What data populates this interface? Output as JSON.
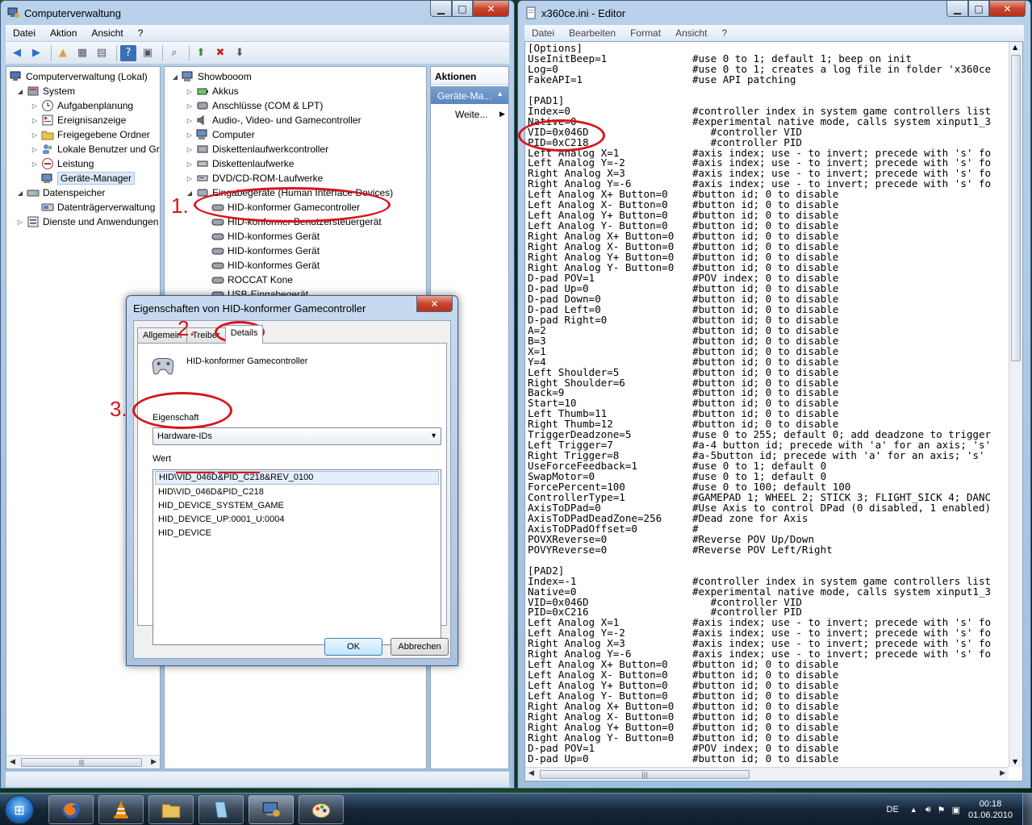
{
  "compmgmt": {
    "title": "Computerverwaltung",
    "menu": [
      "Datei",
      "Aktion",
      "Ansicht",
      "?"
    ],
    "left_tree": [
      {
        "label": "Computerverwaltung (Lokal)",
        "indent": 0,
        "twisty": ""
      },
      {
        "label": "System",
        "indent": 1,
        "twisty": "◢"
      },
      {
        "label": "Aufgabenplanung",
        "indent": 2,
        "twisty": "▷"
      },
      {
        "label": "Ereignisanzeige",
        "indent": 2,
        "twisty": "▷"
      },
      {
        "label": "Freigegebene Ordner",
        "indent": 2,
        "twisty": "▷"
      },
      {
        "label": "Lokale Benutzer und Gr",
        "indent": 2,
        "twisty": "▷"
      },
      {
        "label": "Leistung",
        "indent": 2,
        "twisty": "▷"
      },
      {
        "label": "Geräte-Manager",
        "indent": 2,
        "twisty": "",
        "selected": true
      },
      {
        "label": "Datenspeicher",
        "indent": 1,
        "twisty": "◢"
      },
      {
        "label": "Datenträgerverwaltung",
        "indent": 2,
        "twisty": ""
      },
      {
        "label": "Dienste und Anwendungen",
        "indent": 1,
        "twisty": "▷"
      }
    ],
    "device_tree": [
      {
        "label": "Showbooom",
        "indent": 0,
        "twisty": "◢"
      },
      {
        "label": "Akkus",
        "indent": 1,
        "twisty": "▷"
      },
      {
        "label": "Anschlüsse (COM & LPT)",
        "indent": 1,
        "twisty": "▷"
      },
      {
        "label": "Audio-, Video- und Gamecontroller",
        "indent": 1,
        "twisty": "▷"
      },
      {
        "label": "Computer",
        "indent": 1,
        "twisty": "▷"
      },
      {
        "label": "Diskettenlaufwerkcontroller",
        "indent": 1,
        "twisty": "▷"
      },
      {
        "label": "Diskettenlaufwerke",
        "indent": 1,
        "twisty": "▷"
      },
      {
        "label": "DVD/CD-ROM-Laufwerke",
        "indent": 1,
        "twisty": "▷"
      },
      {
        "label": "Eingabegeräte (Human Interface Devices)",
        "indent": 1,
        "twisty": "◢"
      },
      {
        "label": "HID-konformer Gamecontroller",
        "indent": 2,
        "twisty": ""
      },
      {
        "label": "HID-konformer Benutzersteuergerät",
        "indent": 2,
        "twisty": ""
      },
      {
        "label": "HID-konformes Gerät",
        "indent": 2,
        "twisty": ""
      },
      {
        "label": "HID-konformes Gerät",
        "indent": 2,
        "twisty": ""
      },
      {
        "label": "HID-konformes Gerät",
        "indent": 2,
        "twisty": ""
      },
      {
        "label": "ROCCAT Kone",
        "indent": 2,
        "twisty": ""
      },
      {
        "label": "USB-Eingabegerät",
        "indent": 2,
        "twisty": ""
      }
    ],
    "actions": {
      "header": "Aktionen",
      "selected": "Geräte-Ma...",
      "more": "Weite..."
    }
  },
  "dialog": {
    "title": "Eigenschaften von HID-konformer Gamecontroller",
    "tabs": [
      "Allgemein",
      "Treiber",
      "Details"
    ],
    "device_name": "HID-konformer Gamecontroller",
    "property_label": "Eigenschaft",
    "property_value": "Hardware-IDs",
    "value_label": "Wert",
    "values": [
      "HID\\VID_046D&PID_C218&REV_0100",
      "HID\\VID_046D&PID_C218",
      "HID_DEVICE_SYSTEM_GAME",
      "HID_DEVICE_UP:0001_U:0004",
      "HID_DEVICE"
    ],
    "ok_label": "OK",
    "cancel_label": "Abbrechen"
  },
  "annotations": {
    "step1": "1.",
    "step2": "2.",
    "step3": "3.",
    "color": "#d8141c"
  },
  "notepad": {
    "title": "x360ce.ini - Editor",
    "menu": [
      "Datei",
      "Bearbeiten",
      "Format",
      "Ansicht",
      "?"
    ],
    "content": "[Options]\nUseInitBeep=1              #use 0 to 1; default 1; beep on init\nLog=0                      #use 0 to 1; creates a log file in folder 'x360ce\nFakeAPI=1                  #use API patching\n\n[PAD1]\nIndex=0                    #controller index in system game controllers list\nNative=0                   #experimental native mode, calls system xinput1_3\nVID=0x046D                    #controller VID\nPID=0xC218                    #controller PID\nLeft Analog X=1            #axis index; use - to invert; precede with 's' fo\nLeft Analog Y=-2           #axis index; use - to invert; precede with 's' fo\nRight Analog X=3           #axis index; use - to invert; precede with 's' fo\nRight Analog Y=-6          #axis index; use - to invert; precede with 's' fo\nLeft Analog X+ Button=0    #button id; 0 to disable\nLeft Analog X- Button=0    #button id; 0 to disable\nLeft Analog Y+ Button=0    #button id; 0 to disable\nLeft Analog Y- Button=0    #button id; 0 to disable\nRight Analog X+ Button=0   #button id; 0 to disable\nRight Analog X- Button=0   #button id; 0 to disable\nRight Analog Y+ Button=0   #button id; 0 to disable\nRight Analog Y- Button=0   #button id; 0 to disable\nD-pad POV=1                #POV index; 0 to disable\nD-pad Up=0                 #button id; 0 to disable\nD-pad Down=0               #button id; 0 to disable\nD-pad Left=0               #button id; 0 to disable\nD-pad Right=0              #button id; 0 to disable\nA=2                        #button id; 0 to disable\nB=3                        #button id; 0 to disable\nX=1                        #button id; 0 to disable\nY=4                        #button id; 0 to disable\nLeft Shoulder=5            #button id; 0 to disable\nRight Shoulder=6           #button id; 0 to disable\nBack=9                     #button id; 0 to disable\nStart=10                   #button id; 0 to disable\nLeft Thumb=11              #button id; 0 to disable\nRight Thumb=12             #button id; 0 to disable\nTriggerDeadzone=5          #use 0 to 255; default 0; add deadzone to trigger\nLeft Trigger=7             #a-4 button id; precede with 'a' for an axis; 's'\nRight Trigger=8            #a-5button id; precede with 'a' for an axis; 's' \nUseForceFeedback=1         #use 0 to 1; default 0\nSwapMotor=0                #use 0 to 1; default 0\nForcePercent=100           #use 0 to 100; default 100\nControllerType=1           #GAMEPAD 1; WHEEL 2; STICK 3; FLIGHT_SICK 4; DANC\nAxisToDPad=0               #Use Axis to control DPad (0 disabled, 1 enabled)\nAxisToDPadDeadZone=256     #Dead zone for Axis\nAxisToDPadOffset=0         #\nPOVXReverse=0              #Reverse POV Up/Down\nPOVYReverse=0              #Reverse POV Left/Right\n\n[PAD2]\nIndex=-1                   #controller index in system game controllers list\nNative=0                   #experimental native mode, calls system xinput1_3\nVID=0x046D                    #controller VID\nPID=0xC216                    #controller PID\nLeft Analog X=1            #axis index; use - to invert; precede with 's' fo\nLeft Analog Y=-2           #axis index; use - to invert; precede with 's' fo\nRight Analog X=3           #axis index; use - to invert; precede with 's' fo\nRight Analog Y=-6          #axis index; use - to invert; precede with 's' fo\nLeft Analog X+ Button=0    #button id; 0 to disable\nLeft Analog X- Button=0    #button id; 0 to disable\nLeft Analog Y+ Button=0    #button id; 0 to disable\nLeft Analog Y- Button=0    #button id; 0 to disable\nRight Analog X+ Button=0   #button id; 0 to disable\nRight Analog X- Button=0   #button id; 0 to disable\nRight Analog Y+ Button=0   #button id; 0 to disable\nRight Analog Y- Button=0   #button id; 0 to disable\nD-pad POV=1                #POV index; 0 to disable\nD-pad Up=0                 #button id; 0 to disable"
  },
  "taskbar": {
    "apps": [
      "firefox-icon",
      "vlc-icon",
      "explorer-icon",
      "notepad-icon",
      "computer-management-icon",
      "paint-icon"
    ],
    "language": "DE",
    "time": "00:18",
    "date": "01.06.2010"
  }
}
